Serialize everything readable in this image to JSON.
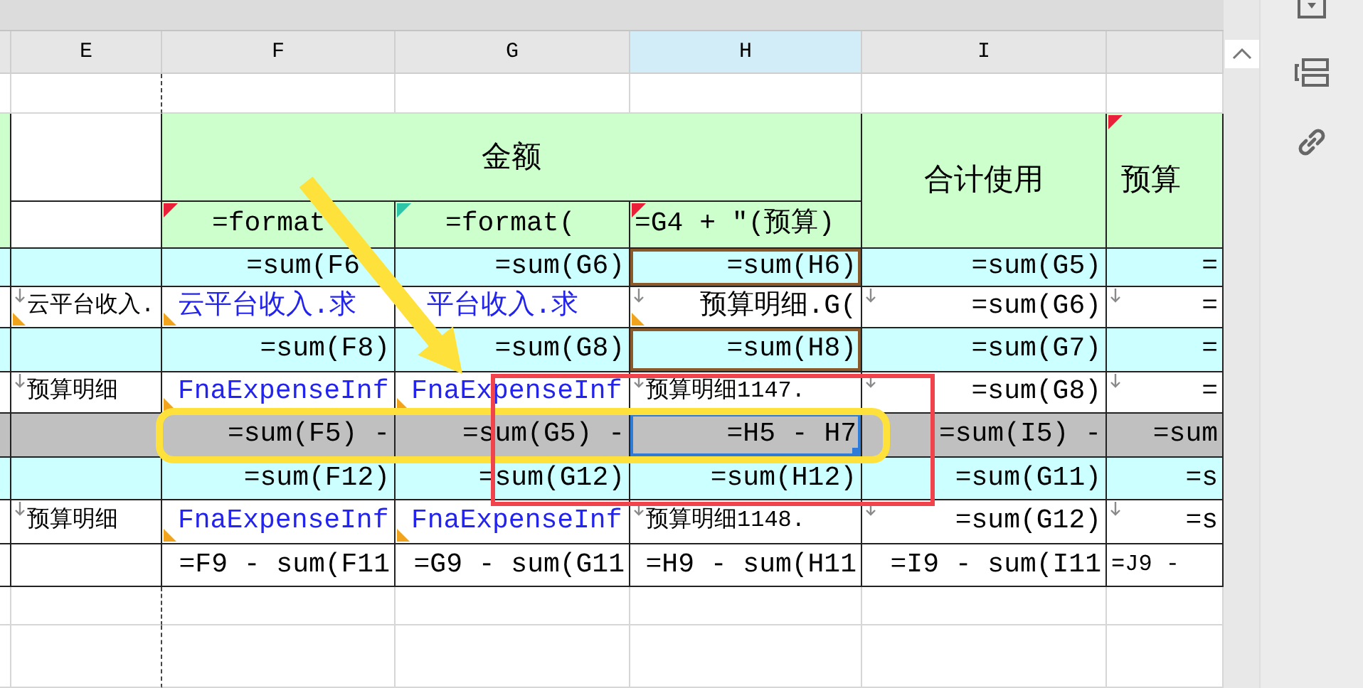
{
  "column_headers": [
    {
      "label": "E",
      "selected": false
    },
    {
      "label": "F",
      "selected": false
    },
    {
      "label": "G",
      "selected": false
    },
    {
      "label": "H",
      "selected": true
    },
    {
      "label": "I",
      "selected": false
    },
    {
      "selected": false
    }
  ],
  "header_band": {
    "group_title": "金额",
    "sub_headers": [
      {
        "text": "=format",
        "kind": "formula",
        "color": "#e8203a"
      },
      {
        "text": "=format(",
        "kind": "formula",
        "color": "#2ec4a8"
      },
      {
        "text": "=G4 + \"(预算)",
        "kind": "label",
        "color": "#e8203a"
      }
    ],
    "total_title": "合计使用",
    "budget_title": {
      "text": "预算",
      "color": "#e8203a"
    }
  },
  "rows": [
    {
      "kind": "cyan",
      "cells": [
        {
          "selected": false,
          "traced": false,
          "error_flag": false,
          "down_arrow": false
        },
        {
          "text": "=sum(F6",
          "kind": "cutformula",
          "selected": false,
          "traced": false,
          "error_flag": false,
          "down_arrow": false
        },
        {
          "text": "=sum(G6)",
          "kind": "formula",
          "selected": false,
          "traced": false,
          "error_flag": false,
          "down_arrow": false
        },
        {
          "text": "=sum(H6)",
          "kind": "formula",
          "selected": false,
          "traced": true,
          "error_flag": false,
          "down_arrow": false
        },
        {
          "text": "=sum(G5)",
          "kind": "formula",
          "selected": false,
          "traced": false,
          "error_flag": false,
          "down_arrow": false
        },
        {
          "text": "=",
          "kind": "formula",
          "selected": false,
          "traced": false,
          "error_flag": false,
          "down_arrow": false
        }
      ]
    },
    {
      "kind": "white",
      "cells": [
        {
          "text": "云平台收入.",
          "kind": "label",
          "selected": false,
          "traced": false,
          "error_flag": true,
          "down_arrow": true
        },
        {
          "text": "云平台收入.求",
          "kind": "link",
          "selected": false,
          "traced": false,
          "error_flag": true,
          "down_arrow": false
        },
        {
          "text": "平台收入.求",
          "kind": "cutlink",
          "selected": false,
          "traced": false,
          "error_flag": false,
          "down_arrow": false
        },
        {
          "text": "预算明细.G(",
          "kind": "formula",
          "selected": false,
          "traced": false,
          "error_flag": true,
          "down_arrow": true
        },
        {
          "text": "=sum(G6)",
          "kind": "formula",
          "selected": false,
          "traced": false,
          "error_flag": false,
          "down_arrow": true
        },
        {
          "text": "=",
          "kind": "formula",
          "selected": false,
          "traced": false,
          "error_flag": false,
          "down_arrow": true
        }
      ]
    },
    {
      "kind": "cyan",
      "cells": [
        {
          "selected": false,
          "traced": false,
          "error_flag": false,
          "down_arrow": false
        },
        {
          "text": "=sum(F8)",
          "kind": "formula",
          "selected": false,
          "traced": false,
          "error_flag": false,
          "down_arrow": false
        },
        {
          "text": "=sum(G8)",
          "kind": "formula",
          "selected": false,
          "traced": false,
          "error_flag": false,
          "down_arrow": false
        },
        {
          "text": "=sum(H8)",
          "kind": "formula",
          "selected": false,
          "traced": true,
          "error_flag": false,
          "down_arrow": false
        },
        {
          "text": "=sum(G7)",
          "kind": "formula",
          "selected": false,
          "traced": false,
          "error_flag": false,
          "down_arrow": false
        },
        {
          "text": "=",
          "kind": "formula",
          "selected": false,
          "traced": false,
          "error_flag": false,
          "down_arrow": false
        }
      ]
    },
    {
      "kind": "white",
      "cells": [
        {
          "text": "预算明细",
          "kind": "label",
          "selected": false,
          "traced": false,
          "error_flag": false,
          "down_arrow": true
        },
        {
          "text": "FnaExpenseInf",
          "kind": "link",
          "selected": false,
          "traced": false,
          "error_flag": true,
          "down_arrow": false
        },
        {
          "text": "FnaExpenseInf",
          "kind": "link",
          "selected": false,
          "traced": false,
          "error_flag": true,
          "down_arrow": false
        },
        {
          "text": "预算明细1147.",
          "kind": "label",
          "selected": false,
          "traced": false,
          "error_flag": false,
          "down_arrow": true
        },
        {
          "text": "=sum(G8)",
          "kind": "formula",
          "selected": false,
          "traced": false,
          "error_flag": false,
          "down_arrow": true
        },
        {
          "text": "=",
          "kind": "formula",
          "selected": false,
          "traced": false,
          "error_flag": false,
          "down_arrow": true
        }
      ]
    },
    {
      "kind": "gray",
      "cells": [
        {
          "selected": false,
          "traced": false,
          "error_flag": false,
          "down_arrow": false
        },
        {
          "text": "=sum(F5) -",
          "kind": "formula",
          "selected": false,
          "traced": false,
          "error_flag": false,
          "down_arrow": false
        },
        {
          "text": "=sum(G5) -",
          "kind": "formula",
          "selected": false,
          "traced": false,
          "error_flag": false,
          "down_arrow": false
        },
        {
          "text": "=H5 - H7",
          "kind": "formula",
          "selected": true,
          "traced": false,
          "error_flag": false,
          "down_arrow": false
        },
        {
          "text": "=sum(I5) -",
          "kind": "formula",
          "selected": false,
          "traced": false,
          "error_flag": false,
          "down_arrow": false
        },
        {
          "text": "=sum",
          "kind": "formula",
          "selected": false,
          "traced": false,
          "error_flag": false,
          "down_arrow": false
        }
      ]
    },
    {
      "kind": "cyan",
      "cells": [
        {
          "selected": false,
          "traced": false,
          "error_flag": false,
          "down_arrow": false
        },
        {
          "text": "=sum(F12)",
          "kind": "formula",
          "selected": false,
          "traced": false,
          "error_flag": false,
          "down_arrow": false
        },
        {
          "text": "=sum(G12)",
          "kind": "formula",
          "selected": false,
          "traced": false,
          "error_flag": false,
          "down_arrow": false
        },
        {
          "text": "=sum(H12)",
          "kind": "formula",
          "selected": false,
          "traced": false,
          "error_flag": false,
          "down_arrow": false
        },
        {
          "text": "=sum(G11)",
          "kind": "formula",
          "selected": false,
          "traced": false,
          "error_flag": false,
          "down_arrow": false
        },
        {
          "text": "=s",
          "kind": "formula",
          "selected": false,
          "traced": false,
          "error_flag": false,
          "down_arrow": false
        }
      ]
    },
    {
      "kind": "white",
      "cells": [
        {
          "text": "预算明细",
          "kind": "label",
          "selected": false,
          "traced": false,
          "error_flag": false,
          "down_arrow": true
        },
        {
          "text": "FnaExpenseInf",
          "kind": "link",
          "selected": false,
          "traced": false,
          "error_flag": true,
          "down_arrow": false
        },
        {
          "text": "FnaExpenseInf",
          "kind": "link",
          "selected": false,
          "traced": false,
          "error_flag": true,
          "down_arrow": false
        },
        {
          "text": "预算明细1148.",
          "kind": "label",
          "selected": false,
          "traced": false,
          "error_flag": false,
          "down_arrow": true
        },
        {
          "text": "=sum(G12)",
          "kind": "formula",
          "selected": false,
          "traced": false,
          "error_flag": false,
          "down_arrow": true
        },
        {
          "text": "=s",
          "kind": "formula",
          "selected": false,
          "traced": false,
          "error_flag": false,
          "down_arrow": true
        }
      ]
    },
    {
      "kind": "white",
      "cells": [
        {
          "selected": false,
          "traced": false,
          "error_flag": false,
          "down_arrow": false
        },
        {
          "text": "=F9 - sum(F11",
          "kind": "formula",
          "selected": false,
          "traced": false,
          "error_flag": false,
          "down_arrow": false
        },
        {
          "text": "=G9 - sum(G11",
          "kind": "formula",
          "selected": false,
          "traced": false,
          "error_flag": false,
          "down_arrow": false
        },
        {
          "text": "=H9 - sum(H11",
          "kind": "formula",
          "selected": false,
          "traced": false,
          "error_flag": false,
          "down_arrow": false
        },
        {
          "text": "=I9 - sum(I11",
          "kind": "formula",
          "selected": false,
          "traced": false,
          "error_flag": false,
          "down_arrow": false
        },
        {
          "text": "=J9 -",
          "kind": "label",
          "selected": false,
          "traced": false,
          "error_flag": false,
          "down_arrow": false
        }
      ]
    }
  ],
  "annotations": [
    {
      "kind": "arrow",
      "color": "#ffe13b"
    },
    {
      "kind": "rounded-frame",
      "color": "#ffe13b"
    },
    {
      "kind": "frame",
      "color": "#f0434b"
    }
  ]
}
